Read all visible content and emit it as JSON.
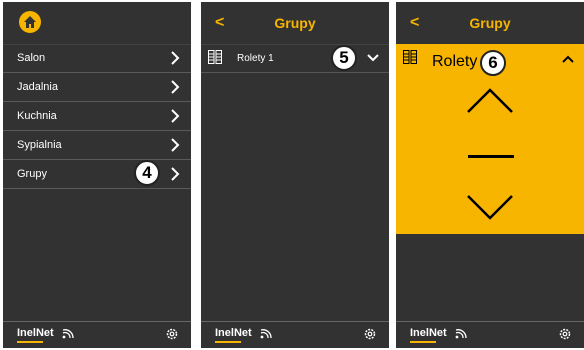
{
  "screen1": {
    "menu": [
      {
        "label": "Salon"
      },
      {
        "label": "Jadalnia"
      },
      {
        "label": "Kuchnia"
      },
      {
        "label": "Sypialnia"
      },
      {
        "label": "Grupy"
      }
    ],
    "badge": "4",
    "footer": {
      "brand": "InelNet"
    }
  },
  "screen2": {
    "title": "Grupy",
    "back": "<",
    "group": {
      "label": "Rolety 1"
    },
    "badge": "5",
    "footer": {
      "brand": "InelNet"
    }
  },
  "screen3": {
    "title": "Grupy",
    "back": "<",
    "group": {
      "label": "Rolety 1"
    },
    "badge": "6",
    "footer": {
      "brand": "InelNet"
    }
  },
  "colors": {
    "accent": "#f7b500",
    "background": "#323232",
    "text": "#ffffff"
  },
  "icons": [
    "home-icon",
    "chevron-right-icon",
    "chevron-down-icon",
    "chevron-up-icon",
    "group-icon",
    "wifi-icon",
    "gear-icon",
    "arrow-up-icon",
    "stop-icon",
    "arrow-down-icon"
  ]
}
